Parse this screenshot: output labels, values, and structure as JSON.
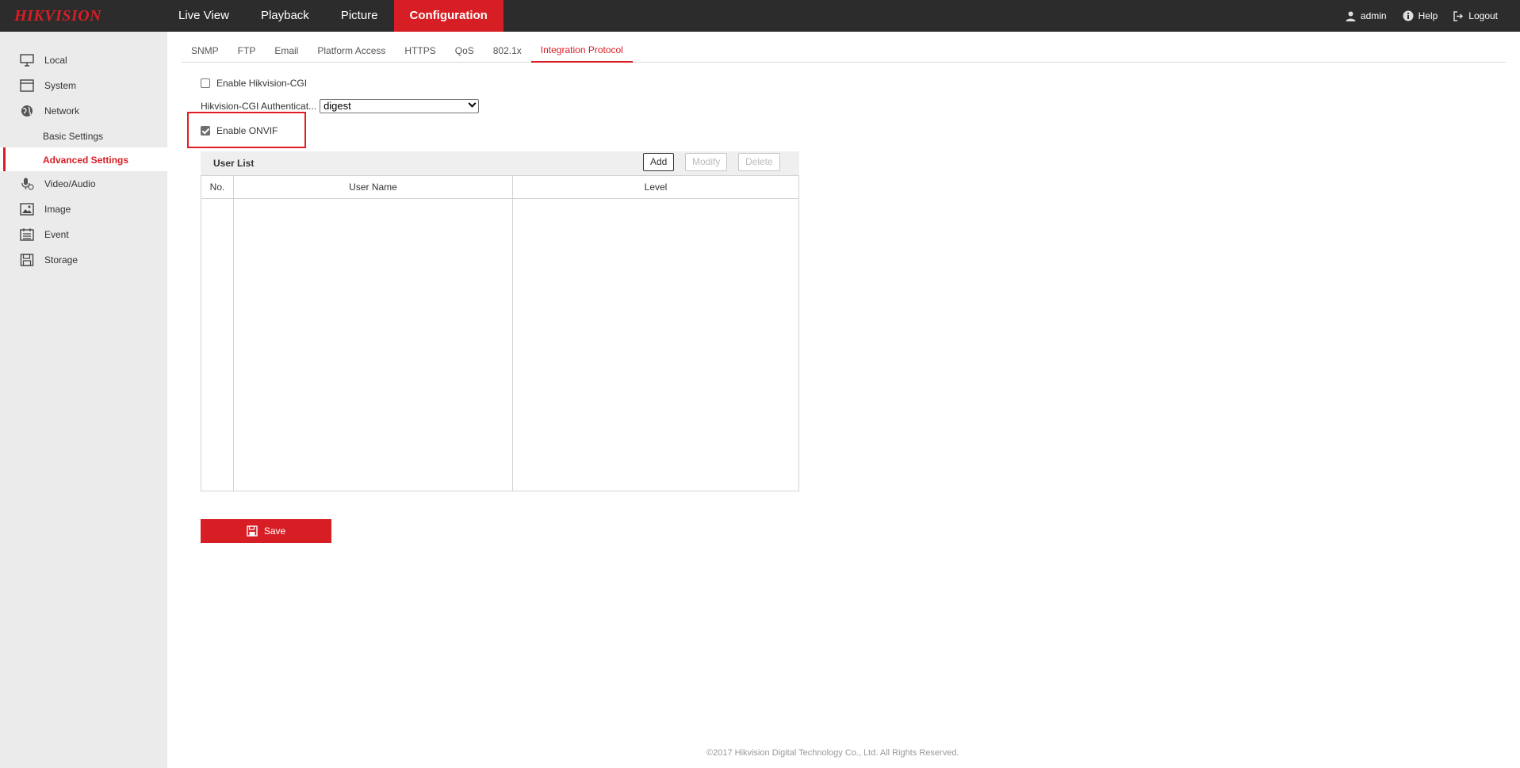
{
  "brand": {
    "logo": "HIKVISION",
    "accent": "#d81e25"
  },
  "top_nav": [
    {
      "label": "Live View"
    },
    {
      "label": "Playback"
    },
    {
      "label": "Picture"
    },
    {
      "label": "Configuration",
      "active": true
    }
  ],
  "top_right": {
    "user": "admin",
    "help": "Help",
    "logout": "Logout"
  },
  "sidebar": {
    "items": [
      {
        "label": "Local",
        "icon": "monitor-icon"
      },
      {
        "label": "System",
        "icon": "system-icon"
      },
      {
        "label": "Network",
        "icon": "globe-icon"
      },
      {
        "label": "Basic Settings",
        "sub": true
      },
      {
        "label": "Advanced Settings",
        "sub": true,
        "active": true
      },
      {
        "label": "Video/Audio",
        "icon": "microphone-icon"
      },
      {
        "label": "Image",
        "icon": "image-icon"
      },
      {
        "label": "Event",
        "icon": "calendar-icon"
      },
      {
        "label": "Storage",
        "icon": "floppy-icon"
      }
    ]
  },
  "subtabs": [
    {
      "label": "SNMP"
    },
    {
      "label": "FTP"
    },
    {
      "label": "Email"
    },
    {
      "label": "Platform Access"
    },
    {
      "label": "HTTPS"
    },
    {
      "label": "QoS"
    },
    {
      "label": "802.1x"
    },
    {
      "label": "Integration Protocol",
      "active": true
    }
  ],
  "form": {
    "enable_cgi_label": "Enable Hikvision-CGI",
    "enable_cgi_checked": false,
    "auth_label": "Hikvision-CGI Authenticat...",
    "auth_value": "digest",
    "enable_onvif_label": "Enable ONVIF",
    "enable_onvif_checked": true
  },
  "user_list": {
    "title": "User List",
    "add": "Add",
    "modify": "Modify",
    "delete": "Delete",
    "columns": [
      "No.",
      "User Name",
      "Level"
    ],
    "rows": []
  },
  "save_label": "Save",
  "footer": "©2017 Hikvision Digital Technology Co., Ltd. All Rights Reserved."
}
